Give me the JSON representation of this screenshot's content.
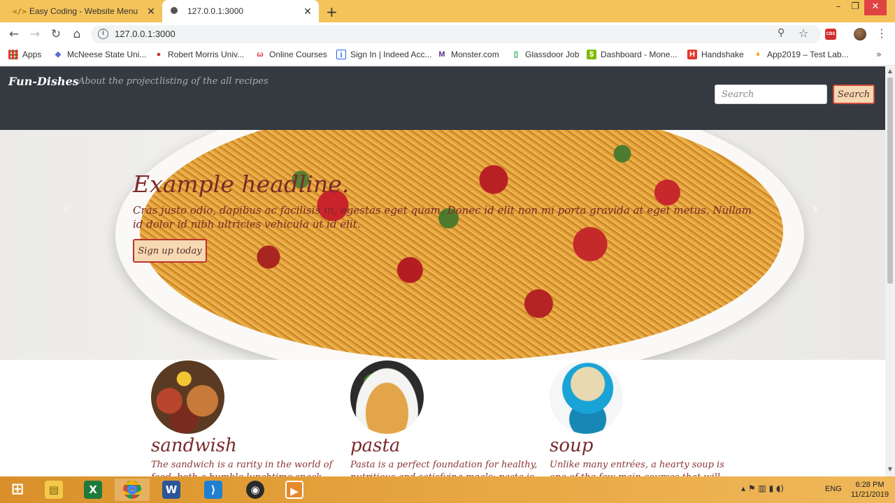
{
  "browser": {
    "tabs": [
      {
        "icon": "</>",
        "title": "Easy Coding - Website Menu",
        "close": "✕"
      },
      {
        "title": "127.0.0.1:3000",
        "close": "✕"
      }
    ],
    "new_tab": "+",
    "window_controls": {
      "minimize": "–",
      "maximize": "❐",
      "close": "✕"
    },
    "nav": {
      "back": "←",
      "forward": "→",
      "reload": "↻",
      "home": "⌂"
    },
    "address": {
      "info": "i",
      "url": "127.0.0.1:3000"
    },
    "toolbar_icons": {
      "zoom": "⚲",
      "star": "☆",
      "extension": "CBS",
      "menu": "⋮"
    },
    "bookmarks": [
      {
        "label": "Apps",
        "icon": "",
        "color": "#e33"
      },
      {
        "label": "McNeese State Uni...",
        "icon": "◆",
        "color": "#5a6fd6"
      },
      {
        "label": "Robert Morris Univ...",
        "icon": "●",
        "color": "#c0392b"
      },
      {
        "label": "Online Courses",
        "icon": "ω",
        "color": "#d23a3a"
      },
      {
        "label": "Sign In | Indeed Acc...",
        "icon": "i",
        "color": "#2164f3"
      },
      {
        "label": "Monster.com",
        "icon": "M",
        "color": "#5a2d91"
      },
      {
        "label": "Glassdoor Job",
        "icon": "▯",
        "color": "#0caa41"
      },
      {
        "label": "Dashboard - Mone...",
        "icon": "$",
        "color": "#7fba00"
      },
      {
        "label": "Handshake",
        "icon": "H",
        "color": "#e0362c"
      },
      {
        "label": "App2019 – Test Lab...",
        "icon": "♦",
        "color": "#f4a300"
      }
    ],
    "bookmarks_more": "»"
  },
  "site": {
    "brand": "Fun-Dishes",
    "nav_links": [
      "About the project",
      "listing of the all recipes"
    ],
    "search": {
      "placeholder": "Search",
      "button": "Search"
    },
    "carousel": {
      "headline": "Example headline.",
      "text": "Cras justo odio, dapibus ac facilisis in, egestas eget quam. Donec id elit non mi porta gravida at eget metus. Nullam id dolor id nibh ultricies vehicula ut id elit.",
      "button": "Sign up today",
      "prev": "‹",
      "next": "›"
    },
    "cards": [
      {
        "title": "sandwish",
        "text": "The sandwich is a rarity in the world of food, both a humble lunchtime snack and a"
      },
      {
        "title": "pasta",
        "text": "Pasta is a perfect foundation for healthy, nutritious and satisfying meals: pasta is"
      },
      {
        "title": "soup",
        "text": "Unlike many entrées, a hearty soup is one of the few main courses that will allow you"
      }
    ]
  },
  "scrollbar": {
    "up": "▲",
    "down": "▼"
  },
  "taskbar": {
    "apps": [
      {
        "name": "start",
        "glyph": "⊞"
      },
      {
        "name": "file-explorer",
        "glyph": "▤"
      },
      {
        "name": "excel",
        "glyph": "X"
      },
      {
        "name": "chrome",
        "glyph": ""
      },
      {
        "name": "word",
        "glyph": "W"
      },
      {
        "name": "vscode",
        "glyph": "⟩"
      },
      {
        "name": "obs",
        "glyph": "◉"
      },
      {
        "name": "media-player",
        "glyph": "▶"
      }
    ],
    "tray_icons": "▴ ⚑ ▥ ▮ ◖)",
    "language": "ENG",
    "time": "6:28 PM",
    "date": "11/21/2019"
  }
}
